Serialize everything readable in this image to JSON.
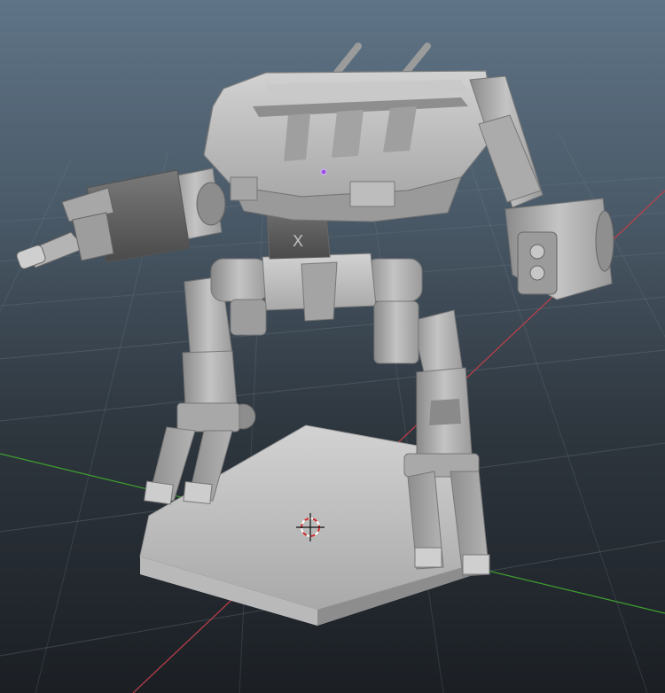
{
  "viewport": {
    "view": "perspective",
    "background_top": "#5f7487",
    "background_bottom": "#1b1f24",
    "grid_color": "#6f7c86",
    "x_axis_color": "#c0404a",
    "z_axis_color": "#3fa02f",
    "model_color": "#b7b7b7",
    "model_shadow_color": "#6d6d6d"
  },
  "model": {
    "name": "mech",
    "parts": [
      "torso",
      "left-cannon-arm",
      "right-fist-arm",
      "pelvis",
      "left-leg",
      "right-leg",
      "hex-base"
    ]
  },
  "markers": {
    "pivot": "pivot-crosshair-icon",
    "selected_vertex": "selected-vertex-icon"
  }
}
